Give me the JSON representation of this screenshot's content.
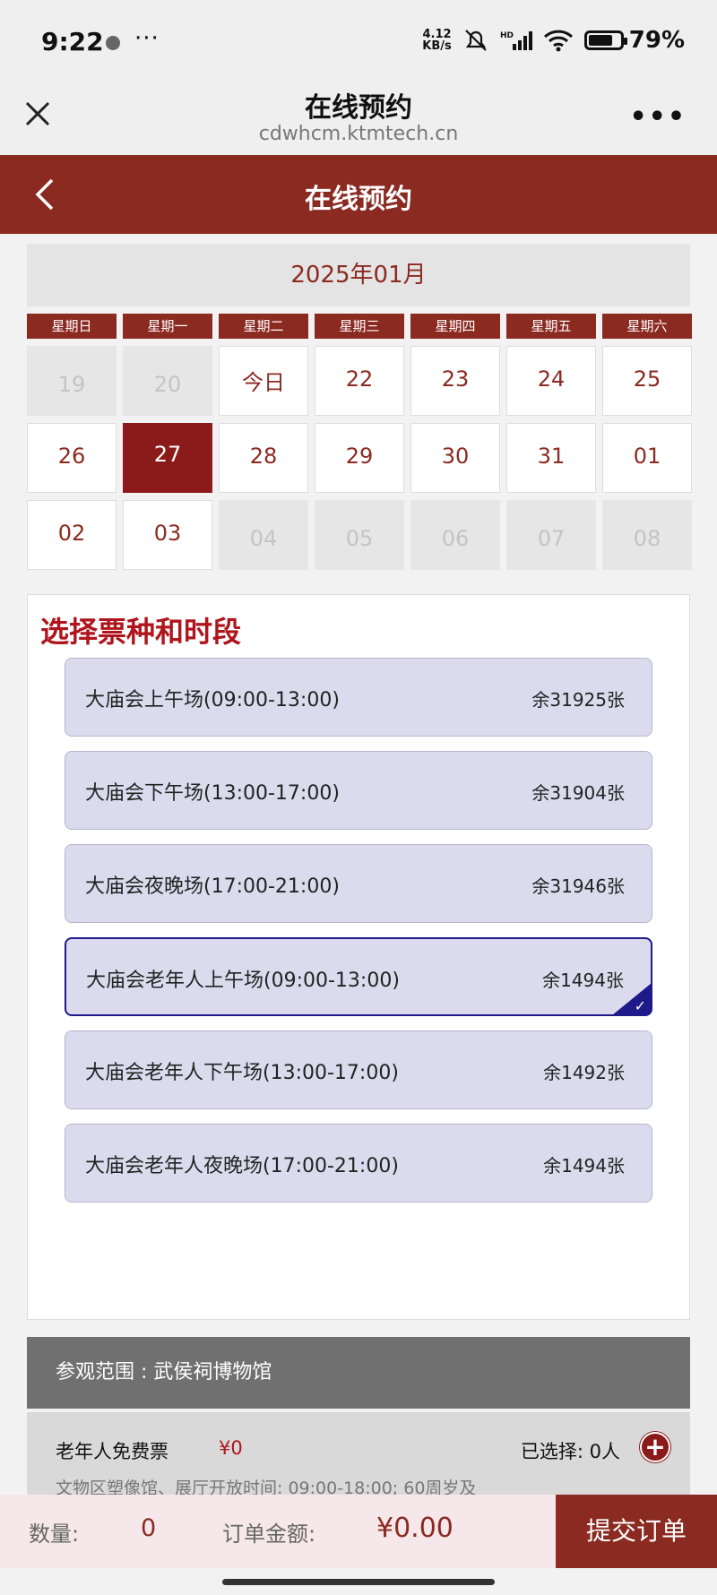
{
  "status_bar": {
    "time": "9:22",
    "more": "···",
    "net_speed_value": "4.12",
    "net_speed_unit": "KB/s",
    "battery": "79%"
  },
  "browser": {
    "title": "在线预约",
    "url": "cdwhcm.ktmtech.cn",
    "menu": "•••"
  },
  "app_header": {
    "title": "在线预约"
  },
  "calendar": {
    "month_label": "2025年01月",
    "weekdays": [
      "星期日",
      "星期一",
      "星期二",
      "星期三",
      "星期四",
      "星期五",
      "星期六"
    ],
    "days": [
      {
        "label": "19",
        "state": "disabled"
      },
      {
        "label": "20",
        "state": "disabled"
      },
      {
        "label": "今日",
        "state": "today"
      },
      {
        "label": "22",
        "state": "normal"
      },
      {
        "label": "23",
        "state": "normal"
      },
      {
        "label": "24",
        "state": "normal"
      },
      {
        "label": "25",
        "state": "normal"
      },
      {
        "label": "26",
        "state": "normal"
      },
      {
        "label": "27",
        "state": "selected"
      },
      {
        "label": "28",
        "state": "normal"
      },
      {
        "label": "29",
        "state": "normal"
      },
      {
        "label": "30",
        "state": "normal"
      },
      {
        "label": "31",
        "state": "normal"
      },
      {
        "label": "01",
        "state": "normal"
      },
      {
        "label": "02",
        "state": "normal"
      },
      {
        "label": "03",
        "state": "normal"
      },
      {
        "label": "04",
        "state": "disabled"
      },
      {
        "label": "05",
        "state": "disabled"
      },
      {
        "label": "06",
        "state": "disabled"
      },
      {
        "label": "07",
        "state": "disabled"
      },
      {
        "label": "08",
        "state": "disabled"
      }
    ]
  },
  "tickets": {
    "heading": "选择票种和时段",
    "options": [
      {
        "name": "大庙会上午场(09:00-13:00)",
        "remaining": "余31925张",
        "selected": false
      },
      {
        "name": "大庙会下午场(13:00-17:00)",
        "remaining": "余31904张",
        "selected": false
      },
      {
        "name": "大庙会夜晚场(17:00-21:00)",
        "remaining": "余31946张",
        "selected": false
      },
      {
        "name": "大庙会老年人上午场(09:00-13:00)",
        "remaining": "余1494张",
        "selected": true
      },
      {
        "name": "大庙会老年人下午场(13:00-17:00)",
        "remaining": "余1492张",
        "selected": false
      },
      {
        "name": "大庙会老年人夜晚场(17:00-21:00)",
        "remaining": "余1494张",
        "selected": false
      }
    ]
  },
  "scope": {
    "text": "参观范围 : 武侯祠博物馆"
  },
  "ticket_type": {
    "name": "老年人免费票",
    "price": "¥0",
    "selected_text": "已选择: 0人",
    "plus": "+",
    "description": "文物区塑像馆、展厅开放时间: 09:00-18:00; 60周岁及"
  },
  "bottom_bar": {
    "quantity_label": "数量:",
    "quantity": "0",
    "amount_label": "订单金额:",
    "amount": "¥0.00",
    "submit_label": "提交订单"
  },
  "colors": {
    "brand": "#8b2a21",
    "selected_day": "#8b1a1a",
    "option_bg": "#dcdbee",
    "option_selected_border": "#1e1a8a",
    "heading_red": "#b0151d"
  }
}
